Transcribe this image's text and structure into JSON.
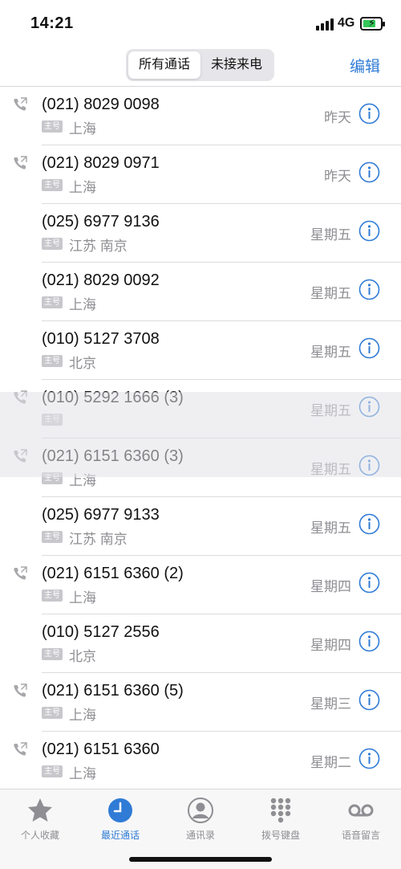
{
  "status_bar": {
    "time": "14:21",
    "network": "4G",
    "battery_percent": 75
  },
  "nav": {
    "segments": [
      "所有通话",
      "未接来电"
    ],
    "selected_segment": "所有通话",
    "edit_label": "编辑"
  },
  "tag_label": "主号",
  "calls": [
    {
      "number": "(021) 8029 0098",
      "location": "上海",
      "day": "昨天",
      "outgoing": true
    },
    {
      "number": "(021) 8029 0971",
      "location": "上海",
      "day": "昨天",
      "outgoing": true
    },
    {
      "number": "(025) 6977 9136",
      "location": "江苏 南京",
      "day": "星期五",
      "outgoing": false
    },
    {
      "number": "(021) 8029 0092",
      "location": "上海",
      "day": "星期五",
      "outgoing": false
    },
    {
      "number": "(010) 5127 3708",
      "location": "北京",
      "day": "星期五",
      "outgoing": false
    },
    {
      "number": "(010) 5292 1666 (3)",
      "location": "",
      "day": "星期五",
      "outgoing": true
    },
    {
      "number": "(021) 6151 6360 (3)",
      "location": "上海",
      "day": "星期五",
      "outgoing": true
    },
    {
      "number": "(025) 6977 9133",
      "location": "江苏 南京",
      "day": "星期五",
      "outgoing": false
    },
    {
      "number": "(021) 6151 6360 (2)",
      "location": "上海",
      "day": "星期四",
      "outgoing": true
    },
    {
      "number": "(010) 5127 2556",
      "location": "北京",
      "day": "星期四",
      "outgoing": false
    },
    {
      "number": "(021) 6151 6360 (5)",
      "location": "上海",
      "day": "星期三",
      "outgoing": true
    },
    {
      "number": "(021) 6151 6360",
      "location": "上海",
      "day": "星期二",
      "outgoing": true
    }
  ],
  "tabs": [
    {
      "label": "个人收藏",
      "icon": "star-icon",
      "active": false
    },
    {
      "label": "最近通话",
      "icon": "clock-icon",
      "active": true
    },
    {
      "label": "通讯录",
      "icon": "contacts-icon",
      "active": false
    },
    {
      "label": "拨号键盘",
      "icon": "keypad-icon",
      "active": false
    },
    {
      "label": "语音留言",
      "icon": "voicemail-icon",
      "active": false
    }
  ],
  "colors": {
    "accent": "#2f7bd6",
    "secondary_text": "#8e8e93",
    "tag_bg": "#c8c8cc"
  }
}
